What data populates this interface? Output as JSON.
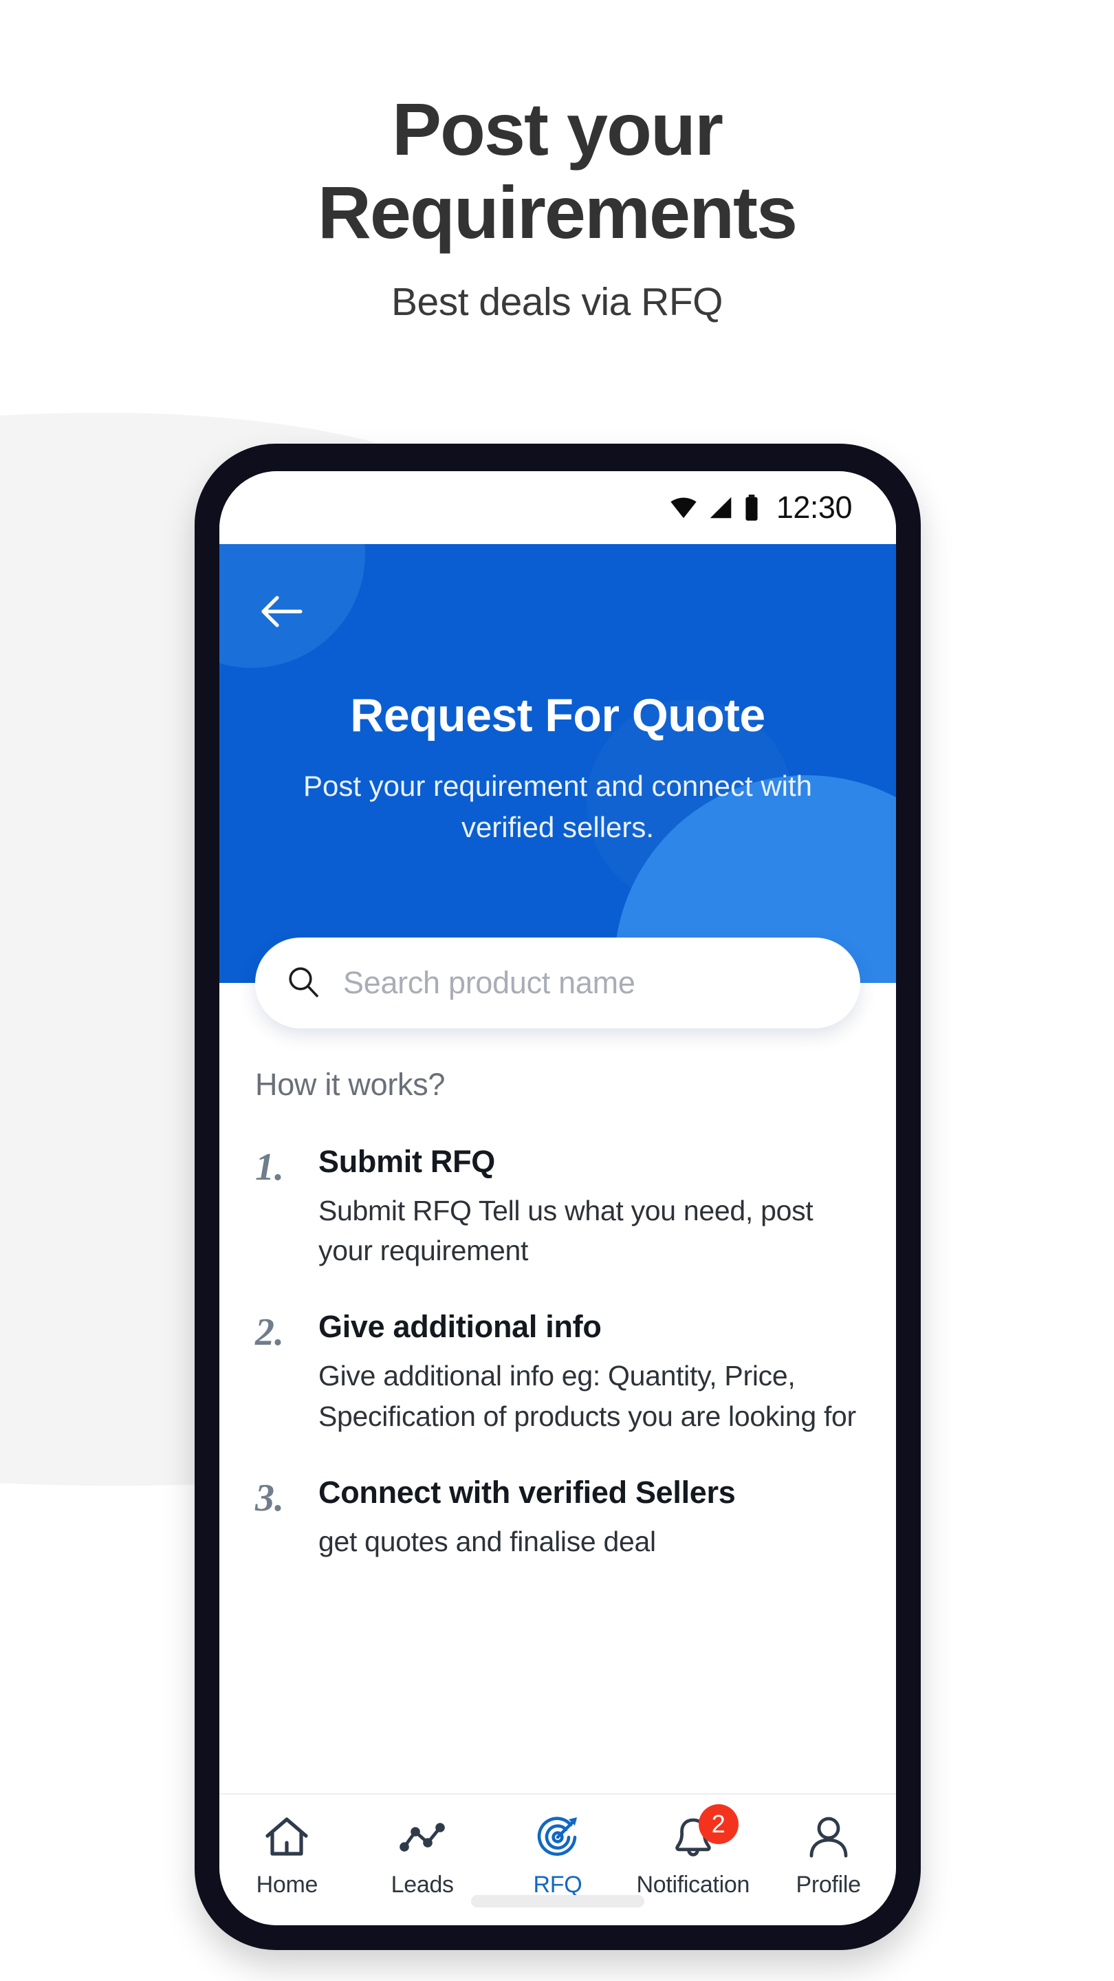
{
  "promo": {
    "title_line1": "Post your",
    "title_line2": "Requirements",
    "subtitle": "Best deals via RFQ"
  },
  "statusbar": {
    "time": "12:30",
    "wifi_icon": "wifi-icon",
    "signal_icon": "signal-icon",
    "battery_icon": "battery-icon"
  },
  "hero": {
    "back_icon": "back-arrow-icon",
    "title": "Request For Quote",
    "subtitle": "Post your requirement and connect with verified sellers.",
    "bg_color": "#0a5ed1",
    "accent_circle_color": "#2e86e8"
  },
  "search": {
    "icon": "search-icon",
    "placeholder": "Search product name",
    "value": ""
  },
  "how_it_works": {
    "heading": "How it works?",
    "steps": [
      {
        "number": "1.",
        "title": "Submit RFQ",
        "description": "Submit RFQ Tell us what you need, post your requirement"
      },
      {
        "number": "2.",
        "title": "Give additional info",
        "description": "Give additional info eg: Quantity, Price, Specification of products you are looking for"
      },
      {
        "number": "3.",
        "title": "Connect with verified Sellers",
        "description": "get quotes and finalise deal"
      }
    ]
  },
  "bottom_nav": {
    "active_color": "#1268c3",
    "badge_color": "#f4331f",
    "items": [
      {
        "label": "Home",
        "icon": "home-icon",
        "active": false,
        "badge": ""
      },
      {
        "label": "Leads",
        "icon": "line-chart-icon",
        "active": false,
        "badge": ""
      },
      {
        "label": "RFQ",
        "icon": "target-arrow-icon",
        "active": true,
        "badge": ""
      },
      {
        "label": "Notification",
        "icon": "bell-icon",
        "active": false,
        "badge": "2"
      },
      {
        "label": "Profile",
        "icon": "person-icon",
        "active": false,
        "badge": ""
      }
    ]
  }
}
